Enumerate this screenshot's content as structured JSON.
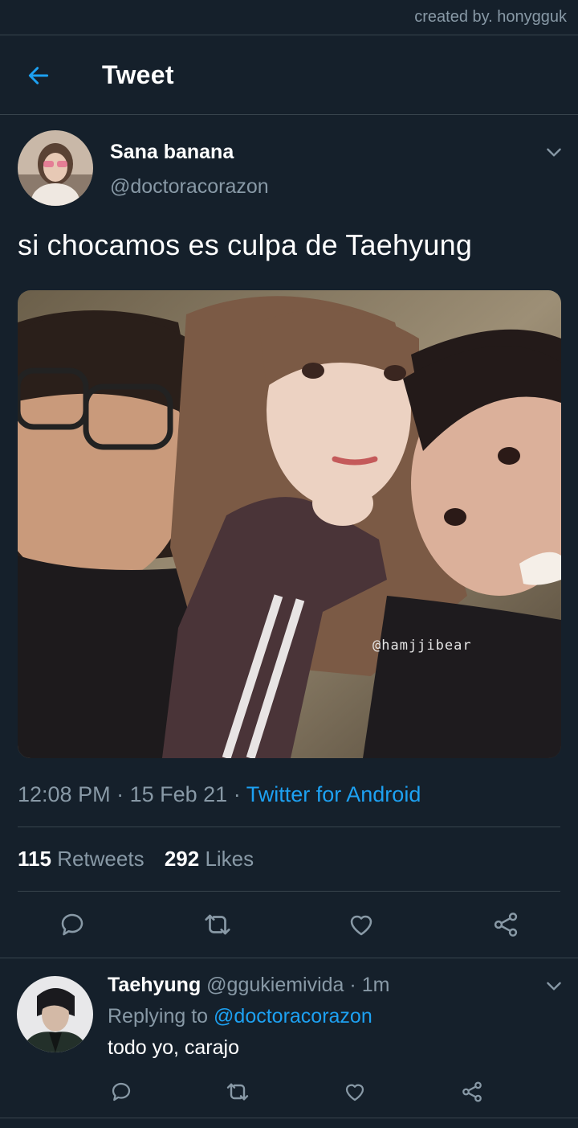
{
  "credit": "created by. honygguk",
  "header": {
    "title": "Tweet",
    "back_icon": "arrow-left-icon",
    "accent": "#1da1f2"
  },
  "tweet": {
    "author_name": "Sana banana",
    "author_handle": "@doctoracorazon",
    "text": "si chocamos es culpa de Taehyung",
    "media_watermark": "@hamjjibear",
    "time": "12:08 PM",
    "date": "15 Feb 21",
    "dot": "·",
    "source": "Twitter for Android",
    "retweets_count": "115",
    "retweets_label": "Retweets",
    "likes_count": "292",
    "likes_label": "Likes",
    "actions": [
      "reply-icon",
      "retweet-icon",
      "like-icon",
      "share-icon"
    ]
  },
  "reply": {
    "author_name": "Taehyung",
    "author_handle": "@ggukiemivida",
    "dot": "·",
    "time": "1m",
    "replying_prefix": "Replying to",
    "replying_to": "@doctoracorazon",
    "text": "todo yo, carajo",
    "actions": [
      "reply-icon",
      "retweet-icon",
      "like-icon",
      "share-icon"
    ]
  },
  "colors": {
    "background": "#15202b",
    "divider": "#38444d",
    "muted": "#8899a6",
    "link": "#1da1f2"
  }
}
